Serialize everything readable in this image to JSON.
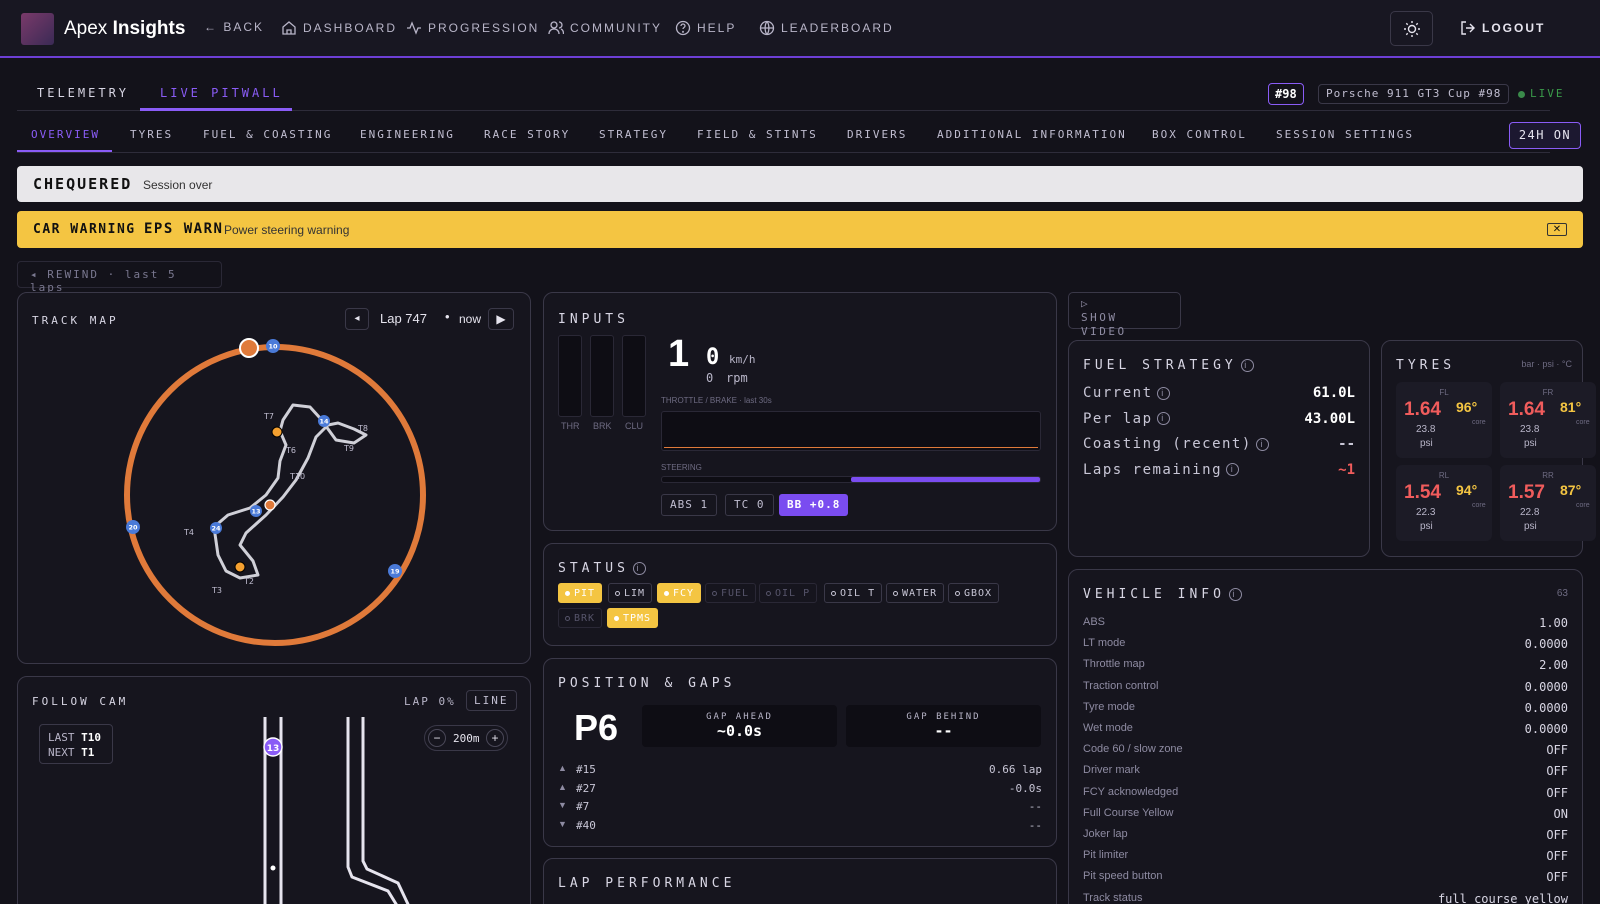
{
  "header": {
    "brand_prefix": "Apex",
    "brand_suffix": "Insights",
    "nav": [
      {
        "label": "← BACK",
        "icon": "back-arrow-icon"
      },
      {
        "label": "DASHBOARD",
        "icon": "home-icon"
      },
      {
        "label": "PROGRESSION",
        "icon": "activity-icon"
      },
      {
        "label": "COMMUNITY",
        "icon": "users-icon"
      },
      {
        "label": "HELP",
        "icon": "help-circle-icon"
      },
      {
        "label": "LEADERBOARD",
        "icon": "globe-icon"
      }
    ],
    "logout_label": "LOGOUT"
  },
  "view_tabs": [
    {
      "label": "TELEMETRY",
      "active": false
    },
    {
      "label": "LIVE PITWALL",
      "active": true
    }
  ],
  "car": {
    "number": "#98",
    "name": "Porsche 911 GT3 Cup #98",
    "live_label": "LIVE"
  },
  "section_tabs": [
    "OVERVIEW",
    "TYRES",
    "FUEL & COASTING",
    "ENGINEERING",
    "RACE STORY",
    "STRATEGY",
    "FIELD & STINTS",
    "DRIVERS",
    "ADDITIONAL INFORMATION",
    "BOX CONTROL",
    "SESSION SETTINGS"
  ],
  "active_section": "OVERVIEW",
  "race_mode_label": "24H ON",
  "banner_flag": {
    "title": "CHEQUERED",
    "text": "Session over"
  },
  "banner_warning": {
    "title": "CAR WARNING",
    "code": "EPS WARN",
    "text": "Power steering warning"
  },
  "rewind_label": "◂ REWIND · last 5 laps",
  "track_map": {
    "title": "TRACK MAP",
    "lap_label": "Lap 747",
    "now_label": "now",
    "markers": [
      "T7",
      "T8",
      "T6",
      "T9",
      "T10",
      "T4",
      "T2",
      "T3"
    ],
    "car_numbers": [
      "10",
      "14",
      "13",
      "24",
      "20",
      "19"
    ]
  },
  "follow_cam": {
    "title": "FOLLOW CAM",
    "lap_label": "LAP 0%",
    "line_button": "LINE",
    "last_label": "LAST",
    "last_value": "T10",
    "next_label": "NEXT",
    "next_value": "T1",
    "zoom": "200m",
    "car_number": "13"
  },
  "inputs": {
    "title": "INPUTS",
    "bars": [
      "THR",
      "BRK",
      "CLU"
    ],
    "gear": "1",
    "speed": "0",
    "speed_unit": "km/h",
    "rpm": "0",
    "rpm_unit": "rpm",
    "trace_label": "THROTTLE / BRAKE · last 30s",
    "steering_label": "STEERING",
    "steering_fraction": 0.5,
    "abs": "ABS 1",
    "tc": "TC 0",
    "bb": "BB +0.8"
  },
  "status": {
    "title": "STATUS",
    "chips": [
      {
        "label": "PIT",
        "state": "on"
      },
      {
        "label": "LIM",
        "state": "off"
      },
      {
        "label": "FCY",
        "state": "on"
      },
      {
        "label": "FUEL",
        "state": "dim"
      },
      {
        "label": "OIL P",
        "state": "dim"
      },
      {
        "label": "OIL T",
        "state": "off"
      },
      {
        "label": "WATER",
        "state": "off"
      },
      {
        "label": "GBOX",
        "state": "off"
      },
      {
        "label": "BRK",
        "state": "dim"
      },
      {
        "label": "TPMS",
        "state": "on"
      }
    ]
  },
  "position": {
    "title": "POSITION & GAPS",
    "position": "P6",
    "gap_ahead_label": "GAP AHEAD",
    "gap_ahead": "~0.0s",
    "gap_behind_label": "GAP BEHIND",
    "gap_behind": "--",
    "rows": [
      {
        "dir": "▲",
        "car": "#15",
        "value": "0.66 lap"
      },
      {
        "dir": "▲",
        "car": "#27",
        "value": "-0.0s"
      },
      {
        "dir": "▼",
        "car": "#7",
        "value": "--"
      },
      {
        "dir": "▼",
        "car": "#40",
        "value": "--"
      }
    ]
  },
  "lap_performance": {
    "title": "LAP PERFORMANCE"
  },
  "video": {
    "label": "SHOW VIDEO"
  },
  "fuel": {
    "title": "FUEL STRATEGY",
    "rows": [
      {
        "label": "Current",
        "value": "61.0L",
        "color": "#ffffff"
      },
      {
        "label": "Per lap",
        "value": "43.00L",
        "color": "#ffffff"
      },
      {
        "label": "Coasting (recent)",
        "value": "--",
        "color": "#c8c6d6"
      },
      {
        "label": "Laps remaining",
        "value": "~1",
        "color": "#f05c5c"
      }
    ]
  },
  "tyres": {
    "title": "TYRES",
    "units": "bar · psi · °C",
    "corners": [
      {
        "pos": "FL",
        "bar": "1.64",
        "psi": "23.8",
        "temp": "96°",
        "core": "core"
      },
      {
        "pos": "FR",
        "bar": "1.64",
        "psi": "23.8",
        "temp": "81°",
        "core": "core"
      },
      {
        "pos": "RL",
        "bar": "1.54",
        "psi": "22.3",
        "temp": "94°",
        "core": "core"
      },
      {
        "pos": "RR",
        "bar": "1.57",
        "psi": "22.8",
        "temp": "87°",
        "core": "core"
      }
    ],
    "psi_label": "psi"
  },
  "vehicle_info": {
    "title": "VEHICLE INFO",
    "count": "63",
    "rows": [
      {
        "label": "ABS",
        "value": "1.00"
      },
      {
        "label": "LT mode",
        "value": "0.0000"
      },
      {
        "label": "Throttle map",
        "value": "2.00"
      },
      {
        "label": "Traction control",
        "value": "0.0000"
      },
      {
        "label": "Tyre mode",
        "value": "0.0000"
      },
      {
        "label": "Wet mode",
        "value": "0.0000"
      },
      {
        "label": "Code 60 / slow zone",
        "value": "OFF"
      },
      {
        "label": "Driver mark",
        "value": "OFF"
      },
      {
        "label": "FCY acknowledged",
        "value": "OFF"
      },
      {
        "label": "Full Course Yellow",
        "value": "ON"
      },
      {
        "label": "Joker lap",
        "value": "OFF"
      },
      {
        "label": "Pit limiter",
        "value": "OFF"
      },
      {
        "label": "Pit speed button",
        "value": "OFF"
      },
      {
        "label": "Track status",
        "value": "full_course_yellow"
      }
    ]
  },
  "colors": {
    "accent": "#8a5cf6",
    "warning": "#f4c542",
    "track": "#e07a3a",
    "danger": "#f05c5c"
  }
}
